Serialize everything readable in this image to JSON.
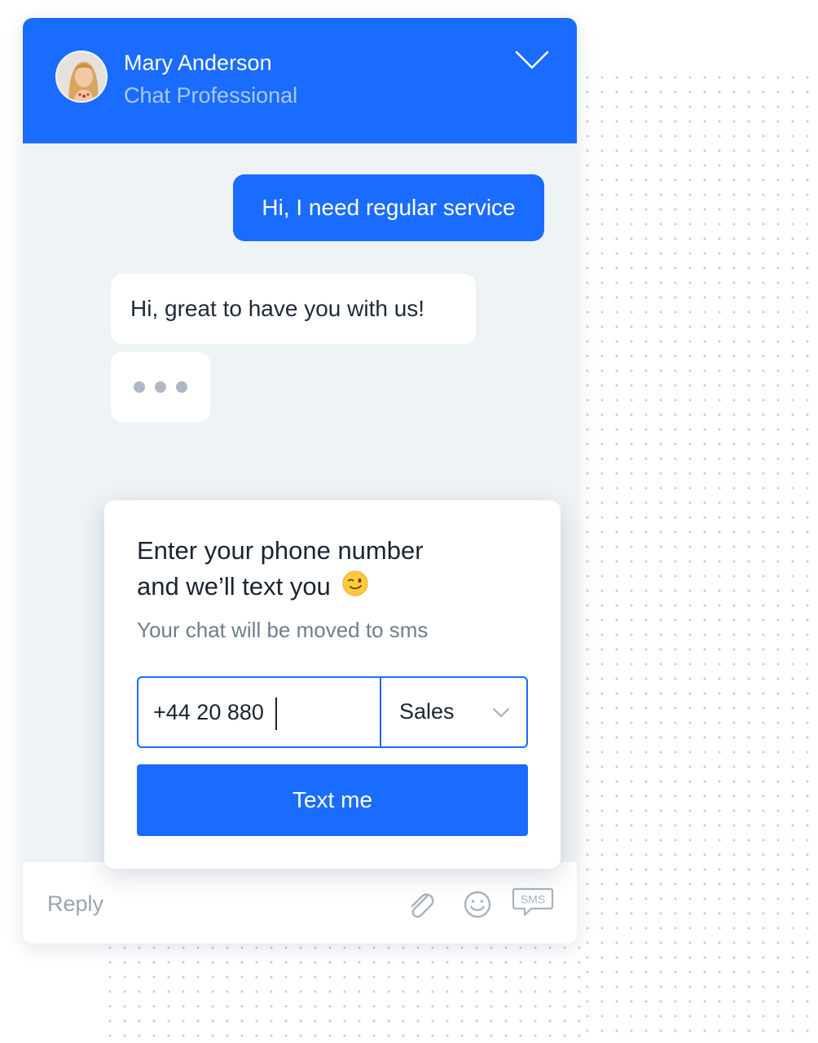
{
  "header": {
    "agent_name": "Mary Anderson",
    "agent_role": "Chat Professional"
  },
  "messages": [
    {
      "direction": "outgoing",
      "text": "Hi, I need regular service"
    },
    {
      "direction": "incoming",
      "text": "Hi, great to have you with us!"
    }
  ],
  "sms_card": {
    "title_line1": "Enter your phone number",
    "title_line2": "and we’ll text you",
    "title_emoji": "😉",
    "subtitle": "Your chat will be moved to sms",
    "phone_value": "+44 20 880",
    "department_selected": "Sales",
    "submit_label": "Text me"
  },
  "reply_bar": {
    "placeholder": "Reply",
    "sms_icon_text": "SMS",
    "icons": [
      "paperclip-icon",
      "smiley-icon",
      "sms-icon"
    ]
  },
  "colors": {
    "accent": "#1a6cff",
    "chat_background": "#eef3f6",
    "header_subtitle": "#a9c8ff",
    "muted_text": "#6d7e8f"
  }
}
